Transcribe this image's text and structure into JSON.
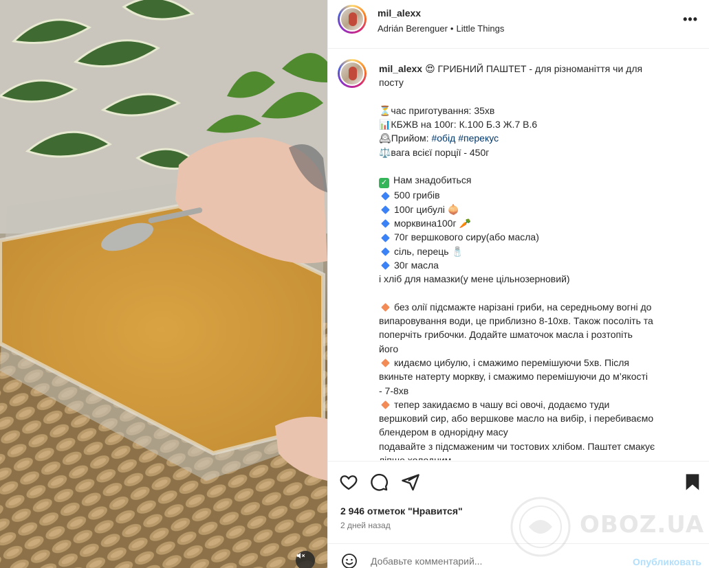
{
  "post": {
    "author": "mil_alexx",
    "audio": {
      "artist": "Adrián Berenguer",
      "separator": "•",
      "track": "Little Things"
    }
  },
  "caption": {
    "author": "mil_alexx",
    "lines": [
      {
        "id": "l1",
        "text": "😍 ГРИБНИЙ ПАШТЕТ - для різноманіття чи для посту"
      }
    ],
    "title": "😍 ГРИБНИЙ ПАШТЕТ - для різноманіття чи для",
    "title2": "посту",
    "time": "⏳час приготування: 35хв",
    "kbzhv": "📊КБЖВ на 100г: К.100 Б.3 Ж.7 В.6",
    "meal_prefix": "🕰Прийом: ",
    "tag1": "#обід",
    "tag2": "#перекус",
    "weight": "⚖️вага всієї порції - 450г",
    "need": "Нам знадобиться",
    "ingredients": [
      "500 грибів",
      "100г цибулі 🧅",
      "морквина100г 🥕",
      "70г вершкового сиру(або масла)",
      "сіль, перець 🧂",
      "30г масла"
    ],
    "bread": "і хліб для намазки(у мене цільнозерновий)",
    "step1a": "без олії підсмажте нарізані гриби, на середньому вогні до",
    "step1b": "випаровування води, це приблизно 8-10хв. Також посоліть та",
    "step1c": "поперчіть грибочки. Додайте шматочок масла і розтопіть",
    "step1d": "його",
    "step2a": "кидаємо цибулю, і смажимо перемішуючи 5хв. Після",
    "step2b": "вкиньте натерту моркву, і смажимо перемішуючи до м’якості",
    "step2c": "- 7-8хв",
    "step3a": "тепер закидаємо в чашу всі овочі, додаємо туди",
    "step3b": "вершковий сир, або вершкове масло на вибір, і перебиваємо",
    "step3c": "блендером в однорідну масу",
    "serve1": "подавайте з підсмаженим чи тостових хлібом. Паштет смакує",
    "serve2": "ліпше холодним."
  },
  "stats": {
    "likes": "2 946 отметок \"Нравится\"",
    "date": "2 дней назад"
  },
  "comment": {
    "placeholder": "Добавьте комментарий...",
    "post_label": "Опубликовать"
  },
  "watermark": {
    "text": "OBOZ.UA"
  },
  "colors": {
    "accent": "#0095f6",
    "post_disabled": "#b2dffc",
    "hashtag": "#00376b",
    "text": "#262626",
    "muted": "#737373"
  }
}
